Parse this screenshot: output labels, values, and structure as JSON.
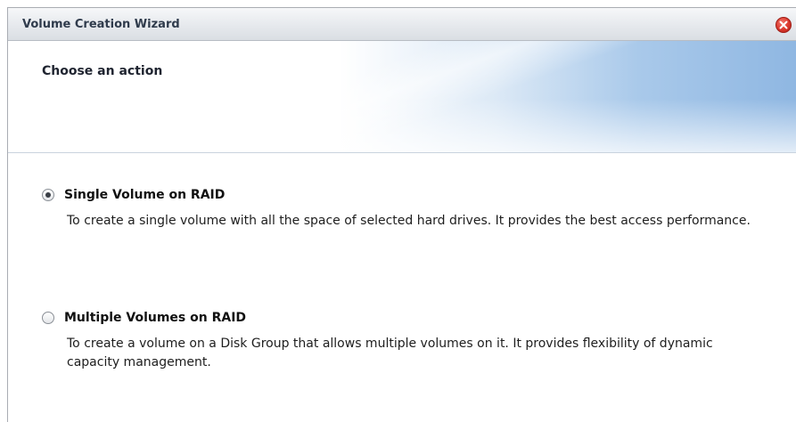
{
  "window": {
    "title": "Volume Creation Wizard",
    "close_icon": "close-circle-red"
  },
  "header": {
    "title": "Choose an action"
  },
  "options": [
    {
      "label": "Single Volume on RAID",
      "description": "To create a single volume with all the space of selected hard drives. It provides the best access performance.",
      "selected": true
    },
    {
      "label": "Multiple Volumes on RAID",
      "description": "To create a volume on a Disk Group that allows multiple volumes on it. It provides flexibility of dynamic capacity management.",
      "selected": false
    }
  ],
  "colors": {
    "close_button": "#d9362b",
    "header_gradient": "#8fb7e2",
    "title_text": "#2f3b4c"
  }
}
